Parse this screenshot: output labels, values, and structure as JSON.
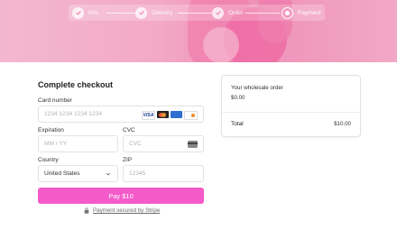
{
  "stepper": {
    "steps": [
      {
        "label": "Info",
        "state": "done"
      },
      {
        "label": "Delivery",
        "state": "done"
      },
      {
        "label": "Order",
        "state": "done"
      },
      {
        "label": "Payment",
        "state": "current"
      }
    ]
  },
  "checkout": {
    "title": "Complete checkout",
    "card_number": {
      "label": "Card number",
      "placeholder": "1234 1234 1234 1234"
    },
    "card_brands": [
      "visa",
      "mastercard",
      "amex",
      "discover"
    ],
    "visa_text": "VISA",
    "expiration": {
      "label": "Expiration",
      "placeholder": "MM / YY"
    },
    "cvc": {
      "label": "CVC",
      "placeholder": "CVC"
    },
    "country": {
      "label": "Country",
      "value": "United States"
    },
    "zip": {
      "label": "ZIP",
      "placeholder": "12345"
    },
    "pay_button": "Pay $10",
    "secured_text": "Payment secured by Stripe"
  },
  "summary": {
    "title": "Your wholesale order",
    "subtotal": "$0.00",
    "total_label": "Total",
    "total_value": "$10.00"
  },
  "colors": {
    "accent": "#f45ac9",
    "hero_pink": "#f3a9c6"
  },
  "icons": {
    "step_done": "check-icon",
    "step_current": "radio-dot-icon",
    "lock": "lock-icon",
    "country_select": "chevron-down-icon",
    "cvc": "card-back-icon"
  }
}
